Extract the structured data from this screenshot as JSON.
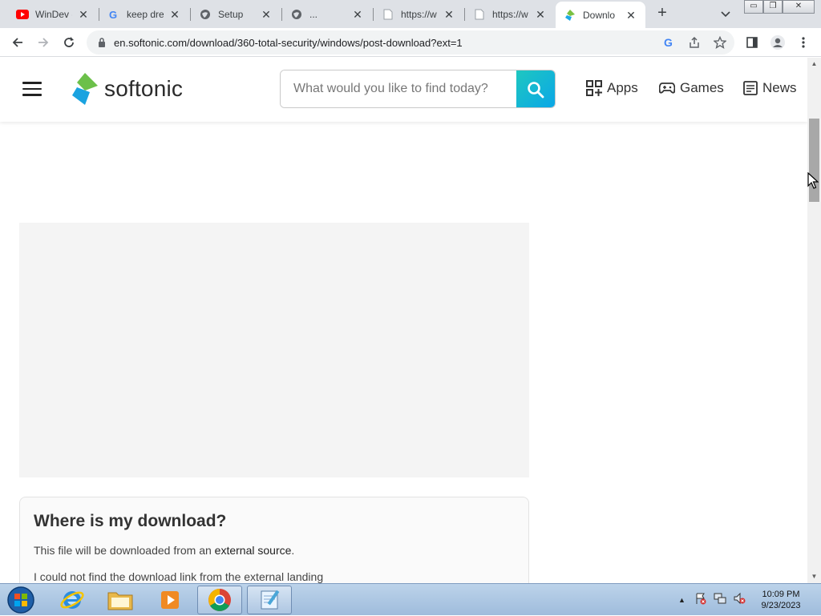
{
  "browser": {
    "tabs": [
      {
        "title": "WinDev -",
        "icon": "youtube-icon"
      },
      {
        "title": "keep dre",
        "icon": "google-icon"
      },
      {
        "title": "Setup",
        "icon": "globe-icon"
      },
      {
        "title": "...",
        "icon": "globe-icon"
      },
      {
        "title": "https://w",
        "icon": "document-icon"
      },
      {
        "title": "https://w",
        "icon": "document-icon"
      },
      {
        "title": "Downlo",
        "icon": "softonic-icon",
        "active": true
      }
    ],
    "url": "en.softonic.com/download/360-total-security/windows/post-download?ext=1"
  },
  "site": {
    "logo_text": "softonic",
    "search_placeholder": "What would you like to find today?",
    "nav": [
      {
        "label": "Apps",
        "icon": "apps-grid-icon"
      },
      {
        "label": "Games",
        "icon": "gamepad-icon"
      },
      {
        "label": "News",
        "icon": "news-icon"
      }
    ]
  },
  "download_card": {
    "heading": "Where is my download?",
    "line1_prefix": "This file will be downloaded from an ",
    "line1_link": "external source",
    "line1_suffix": ".",
    "line2": "I could not find the download link from the external landing"
  },
  "taskbar": {
    "time": "10:09 PM",
    "date": "9/23/2023"
  },
  "colors": {
    "accent": "#14b8d4",
    "tabstrip": "#dee1e6"
  }
}
